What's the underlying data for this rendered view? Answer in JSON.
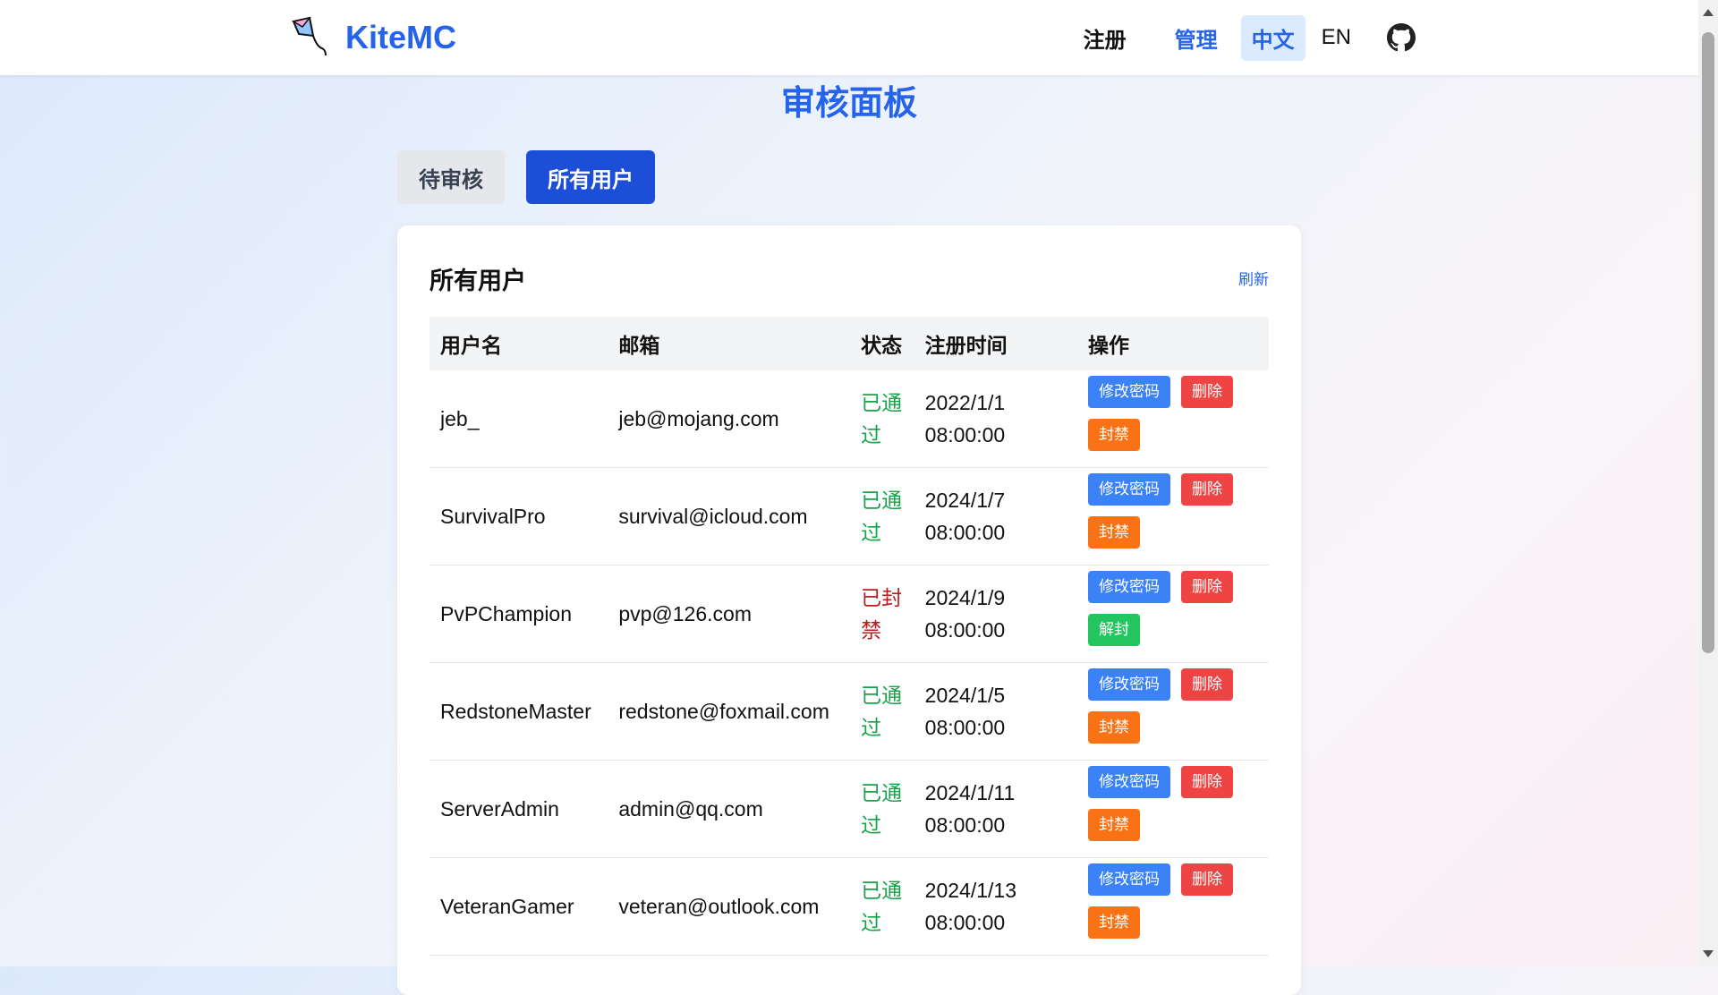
{
  "brand": {
    "name": "KiteMC"
  },
  "nav": {
    "register": "注册",
    "manage": "管理",
    "lang_zh": "中文",
    "lang_en": "EN",
    "github_icon": "github-icon"
  },
  "page": {
    "title": "审核面板"
  },
  "tabs": {
    "pending": "待审核",
    "all": "所有用户"
  },
  "card": {
    "title": "所有用户",
    "refresh": "刷新"
  },
  "table": {
    "headers": {
      "username": "用户名",
      "email": "邮箱",
      "status": "状态",
      "registered": "注册时间",
      "actions": "操作"
    },
    "rows": [
      {
        "username": "jeb_",
        "email": "jeb@mojang.com",
        "status_line1": "已通",
        "status_line2": "过",
        "date": "2022/1/1",
        "time": "08:00:00",
        "btn_pwd": "修改密码",
        "btn_del": "删除",
        "btn_third": "封禁",
        "banned": false
      },
      {
        "username": "SurvivalPro",
        "email": "survival@icloud.com",
        "status_line1": "已通",
        "status_line2": "过",
        "date": "2024/1/7",
        "time": "08:00:00",
        "btn_pwd": "修改密码",
        "btn_del": "删除",
        "btn_third": "封禁",
        "banned": false
      },
      {
        "username": "PvPChampion",
        "email": "pvp@126.com",
        "status_line1": "已封",
        "status_line2": "禁",
        "date": "2024/1/9",
        "time": "08:00:00",
        "btn_pwd": "修改密码",
        "btn_del": "删除",
        "btn_third": "解封",
        "banned": true
      },
      {
        "username": "RedstoneMaster",
        "email": "redstone@foxmail.com",
        "status_line1": "已通",
        "status_line2": "过",
        "date": "2024/1/5",
        "time": "08:00:00",
        "btn_pwd": "修改密码",
        "btn_del": "删除",
        "btn_third": "封禁",
        "banned": false
      },
      {
        "username": "ServerAdmin",
        "email": "admin@qq.com",
        "status_line1": "已通",
        "status_line2": "过",
        "date": "2024/1/11",
        "time": "08:00:00",
        "btn_pwd": "修改密码",
        "btn_del": "删除",
        "btn_third": "封禁",
        "banned": false
      },
      {
        "username": "VeteranGamer",
        "email": "veteran@outlook.com",
        "status_line1": "已通",
        "status_line2": "过",
        "date": "2024/1/13",
        "time": "08:00:00",
        "btn_pwd": "修改密码",
        "btn_del": "删除",
        "btn_third": "封禁",
        "banned": false
      }
    ]
  },
  "colors": {
    "accent": "#2563eb",
    "approved": "#16a34a",
    "banned": "#b91c1c",
    "btn_pwd": "#3b82f6",
    "btn_del": "#ef4444",
    "btn_ban": "#f97316",
    "btn_unban": "#22c55e"
  }
}
